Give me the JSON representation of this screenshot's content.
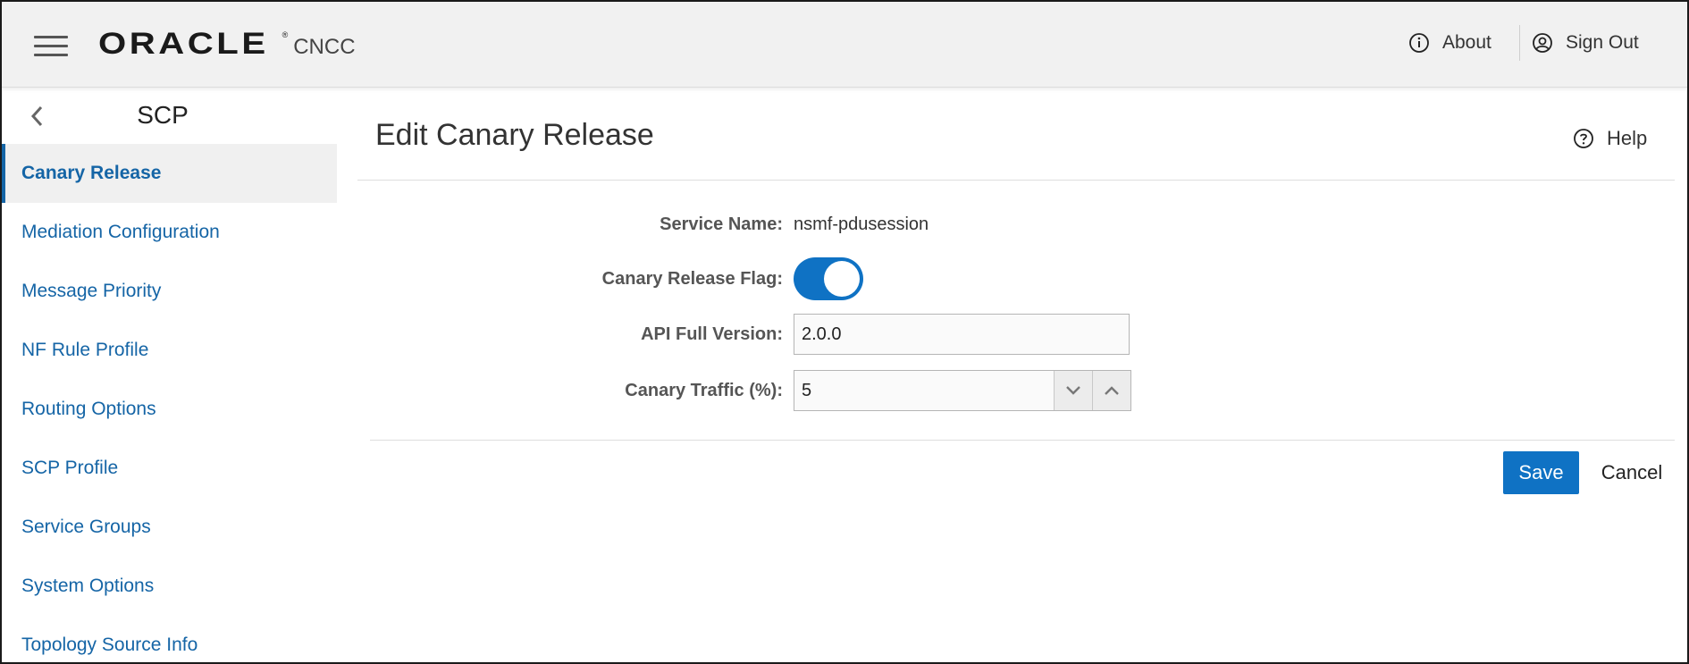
{
  "header": {
    "brand": "ORACLE",
    "registered_mark": "®",
    "product": "CNCC",
    "about_label": "About",
    "signout_label": "Sign Out"
  },
  "sidebar": {
    "title": "SCP",
    "items": [
      {
        "label": "Canary Release",
        "active": true
      },
      {
        "label": "Mediation Configuration"
      },
      {
        "label": "Message Priority"
      },
      {
        "label": "NF Rule Profile"
      },
      {
        "label": "Routing Options"
      },
      {
        "label": "SCP Profile"
      },
      {
        "label": "Service Groups"
      },
      {
        "label": "System Options"
      },
      {
        "label": "Topology Source Info"
      }
    ]
  },
  "main": {
    "title": "Edit Canary Release",
    "help_label": "Help",
    "form": {
      "service_name_label": "Service Name:",
      "service_name_value": "nsmf-pdusession",
      "flag_label": "Canary Release Flag:",
      "flag_on": true,
      "api_version_label": "API Full Version:",
      "api_version_value": "2.0.0",
      "traffic_label": "Canary Traffic (%):",
      "traffic_value": "5"
    },
    "save_label": "Save",
    "cancel_label": "Cancel"
  },
  "colors": {
    "accent": "#0f72c4",
    "link": "#1565a6",
    "header_bg": "#f1f1f1"
  }
}
